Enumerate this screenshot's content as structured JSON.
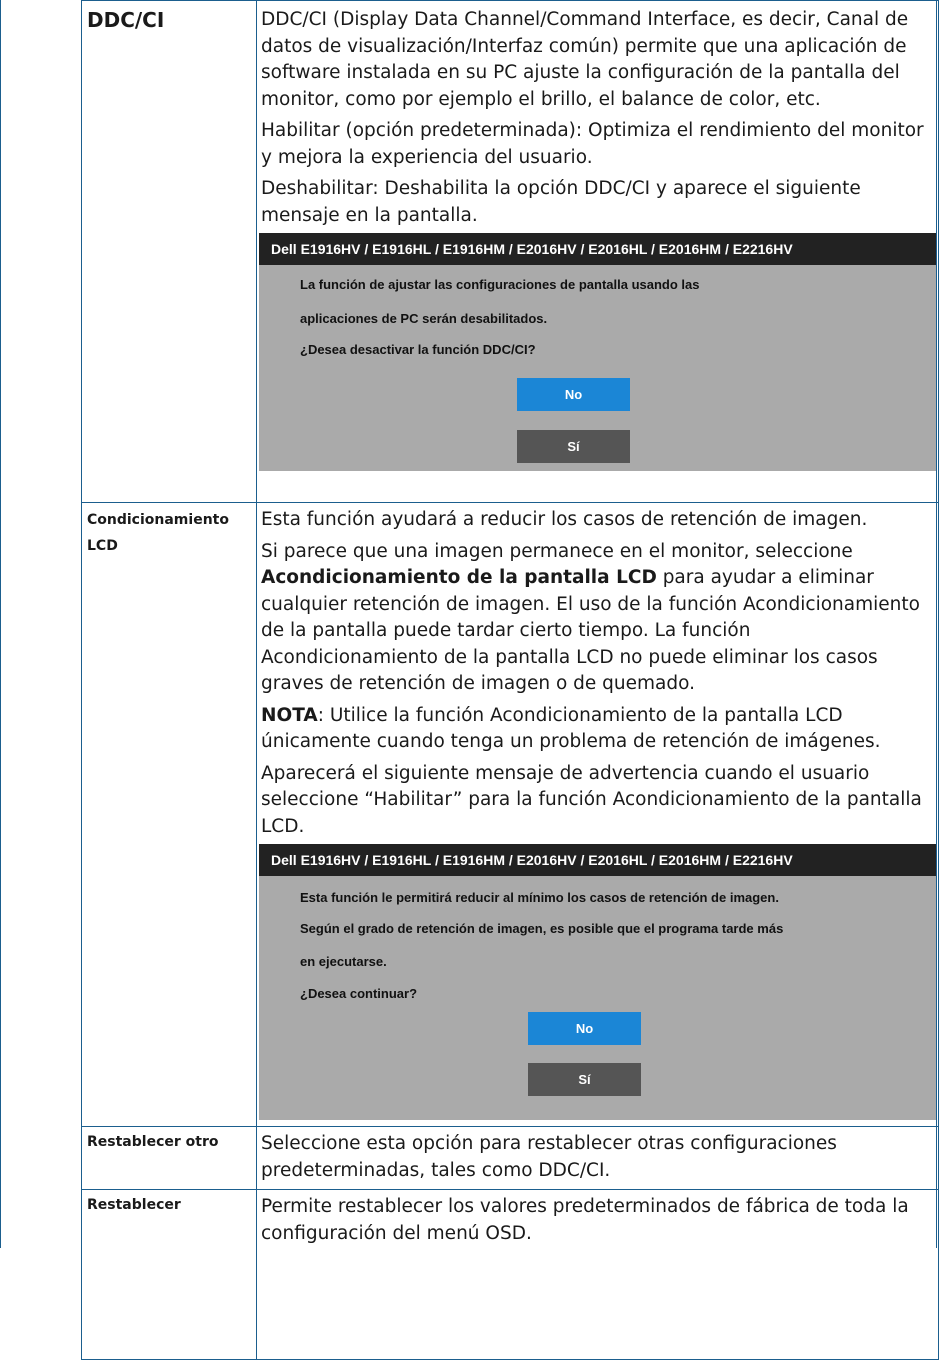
{
  "rows": [
    {
      "name": "DDC/CI",
      "paragraphs": [
        "DDC/CI (Display Data Channel/Command Interface, es decir, Canal de datos de visualización/Interfaz común) permite que una aplicación de software instalada en su PC ajuste la configuración de la pantalla del monitor, como por ejemplo el brillo, el balance de color, etc.",
        "Habilitar (opción predeterminada): Optimiza el rendimiento del monitor y mejora la experiencia del usuario.",
        "Deshabilitar: Deshabilita la opción DDC/CI y aparece el siguiente mensaje en la pantalla."
      ],
      "dialog": {
        "title": "Dell E1916HV / E1916HL / E1916HM / E2016HV / E2016HL / E2016HM / E2216HV",
        "lines": [
          "La función de ajustar las configuraciones de pantalla usando las",
          "aplicaciones de PC serán desabilitados.",
          "¿Desea desactivar la función DDC/CI?"
        ],
        "no_label": "No",
        "si_label": "Sí"
      }
    },
    {
      "name": "Condicionamiento LCD",
      "p1": "Esta función ayudará a reducir los casos de retención de imagen.",
      "p2_pre": "Si parece que una imagen permanece en el monitor, seleccione ",
      "p2_bold": "Acondicionamiento de la pantalla LCD",
      "p2_post": " para ayudar a eliminar cualquier retención de imagen. El uso de la función Acondicionamiento de la pantalla puede tardar cierto tiempo. La función Acondicionamiento de la pantalla LCD no puede eliminar los casos graves de retención de imagen o de quemado.",
      "note_label": "NOTA",
      "note_text": ": Utilice la función Acondicionamiento de la pantalla LCD únicamente cuando tenga un problema de retención de imágenes.",
      "p4": "Aparecerá el siguiente mensaje de advertencia cuando el usuario seleccione “Habilitar” para la función Acondicionamiento de la pantalla LCD.",
      "dialog": {
        "title": "Dell E1916HV / E1916HL / E1916HM / E2016HV / E2016HL / E2016HM / E2216HV",
        "lines": [
          "Esta función le permitirá reducir al mínimo los casos de retención de imagen.",
          "Según el grado de retención de imagen, es posible que el programa tarde más",
          "en ejecutarse.",
          "¿Desea continuar?"
        ],
        "no_label": "No",
        "si_label": "Sí"
      }
    },
    {
      "name": "Restablecer otro",
      "text": "Seleccione esta opción para restablecer otras configuraciones predeterminadas, tales como DDC/CI."
    },
    {
      "name": "Restablecer",
      "text": "Permite restablecer los valores predeterminados de fábrica de toda la configuración del menú OSD."
    }
  ]
}
